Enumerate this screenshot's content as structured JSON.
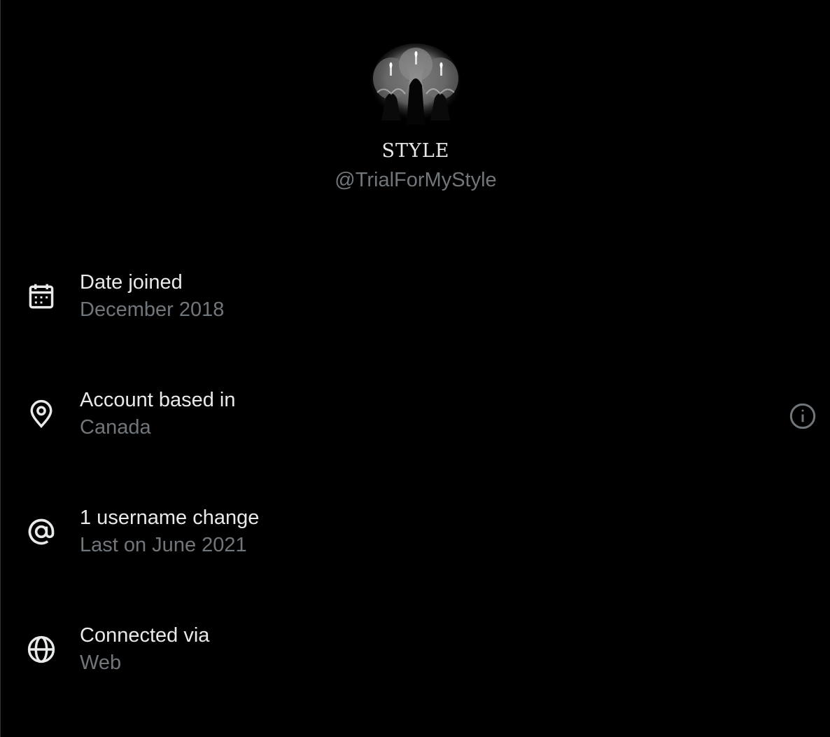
{
  "profile": {
    "display_name": "STYLE",
    "handle": "@TrialForMyStyle"
  },
  "info": [
    {
      "icon": "calendar-icon",
      "title": "Date joined",
      "value": "December 2018"
    },
    {
      "icon": "location-pin-icon",
      "title": "Account based in",
      "value": "Canada",
      "has_info_button": true
    },
    {
      "icon": "at-sign-icon",
      "title": "1 username change",
      "value": "Last on June 2021"
    },
    {
      "icon": "globe-icon",
      "title": "Connected via",
      "value": "Web"
    }
  ],
  "colors": {
    "background": "#000000",
    "primary_text": "#e7e9ea",
    "secondary_text": "#71767b"
  }
}
